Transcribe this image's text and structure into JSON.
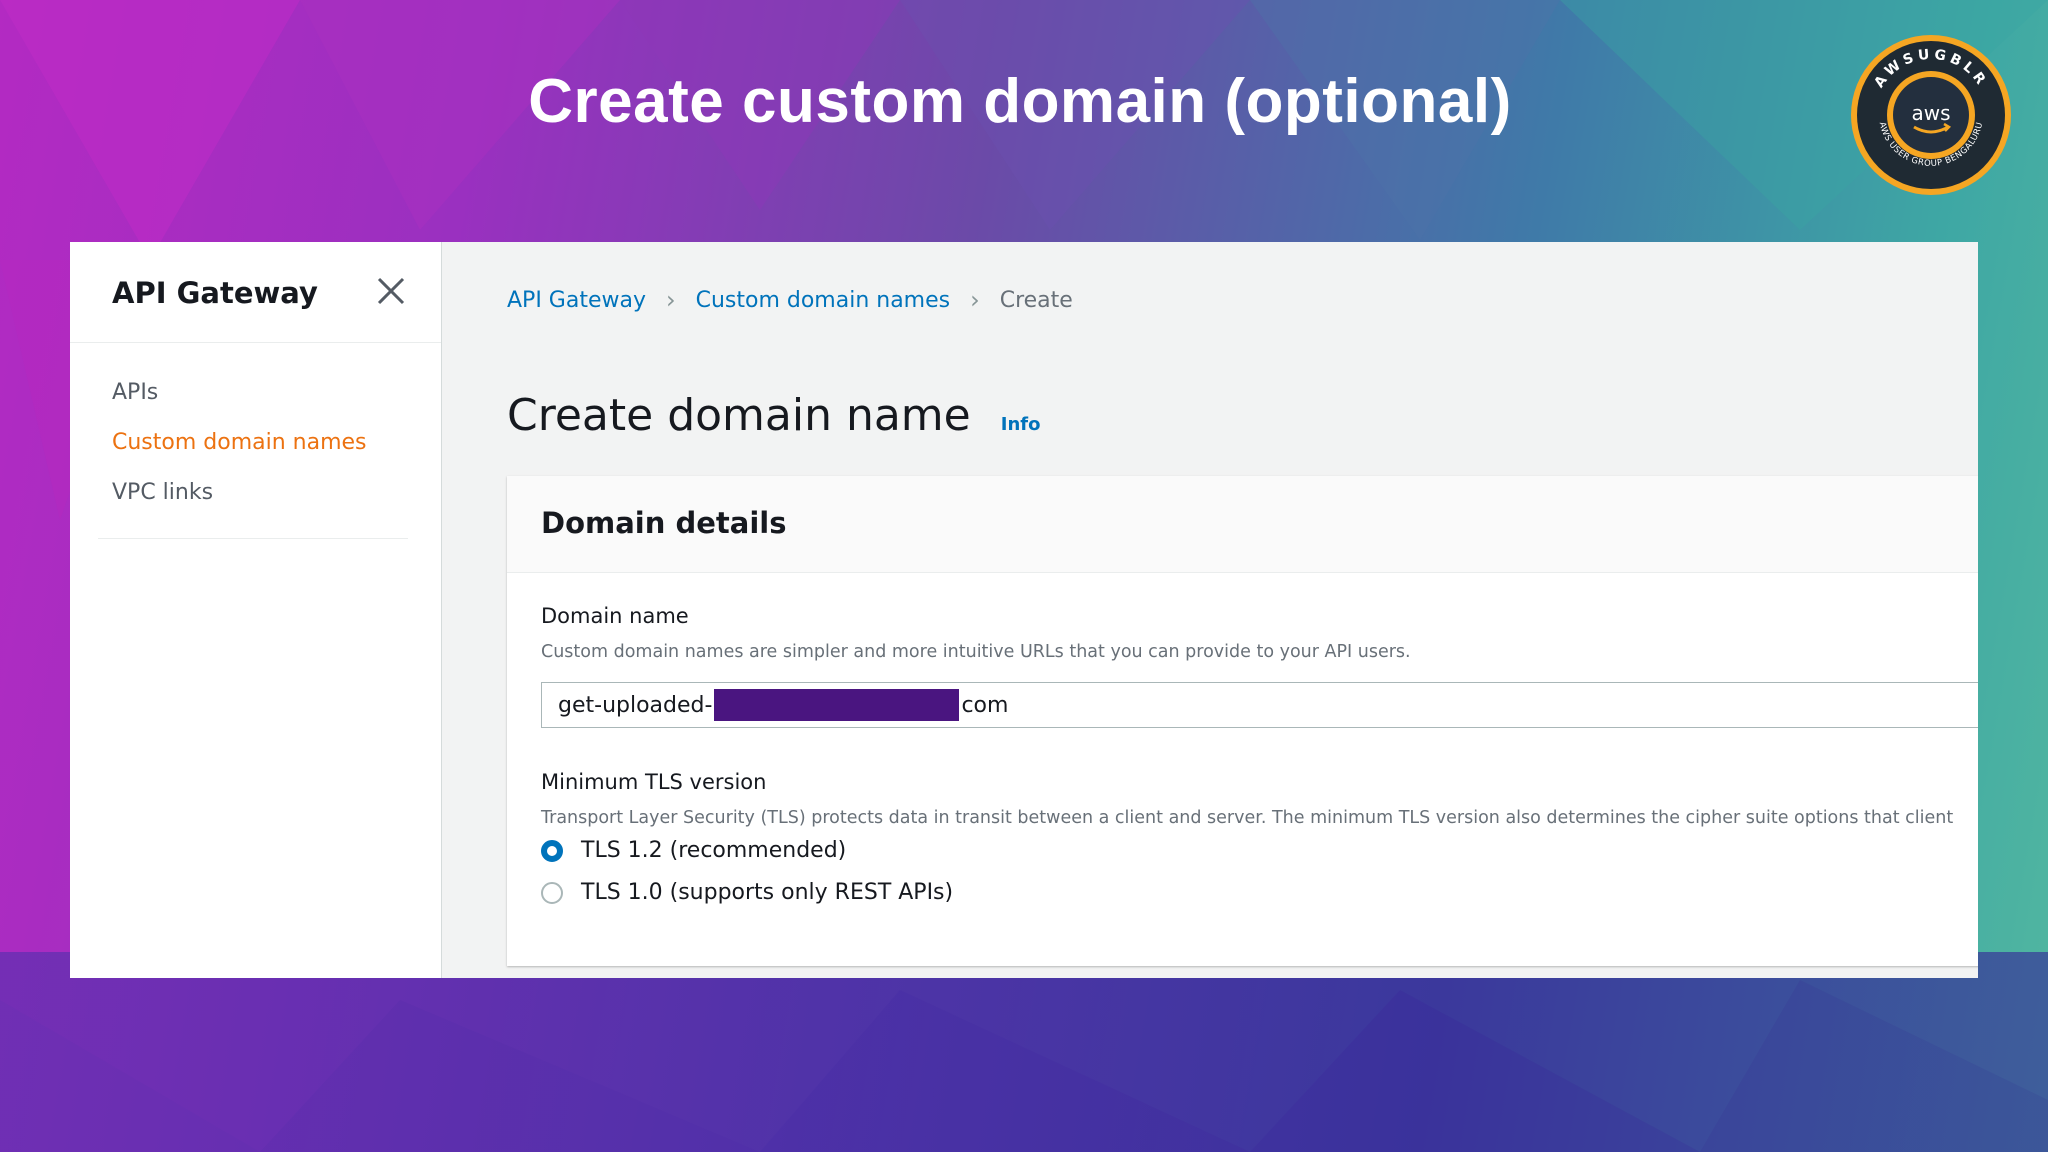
{
  "slide": {
    "title": "Create custom domain (optional)"
  },
  "badge": {
    "text_top": "AWSUGBLR",
    "text_bottom": "AWS USER GROUP BENGALURU",
    "center": "aws"
  },
  "sidenav": {
    "title": "API Gateway",
    "items": [
      {
        "label": "APIs",
        "active": false
      },
      {
        "label": "Custom domain names",
        "active": true
      },
      {
        "label": "VPC links",
        "active": false
      }
    ]
  },
  "breadcrumb": {
    "items": [
      "API Gateway",
      "Custom domain names"
    ],
    "current": "Create"
  },
  "page": {
    "title": "Create domain name",
    "info": "Info"
  },
  "panel": {
    "title": "Domain details",
    "domain_name": {
      "label": "Domain name",
      "description": "Custom domain names are simpler and more intuitive URLs that you can provide to your API users.",
      "value_prefix": "get-uploaded-",
      "value_suffix": "com"
    },
    "tls": {
      "label": "Minimum TLS version",
      "description": "Transport Layer Security (TLS) protects data in transit between a client and server. The minimum TLS version also determines the cipher suite options that client",
      "options": [
        {
          "label": "TLS 1.2 (recommended)",
          "selected": true
        },
        {
          "label": "TLS 1.0 (supports only REST APIs)",
          "selected": false
        }
      ]
    }
  },
  "colors": {
    "accent_orange": "#ec7211",
    "link_blue": "#0073bb",
    "redaction": "#4a1580"
  }
}
